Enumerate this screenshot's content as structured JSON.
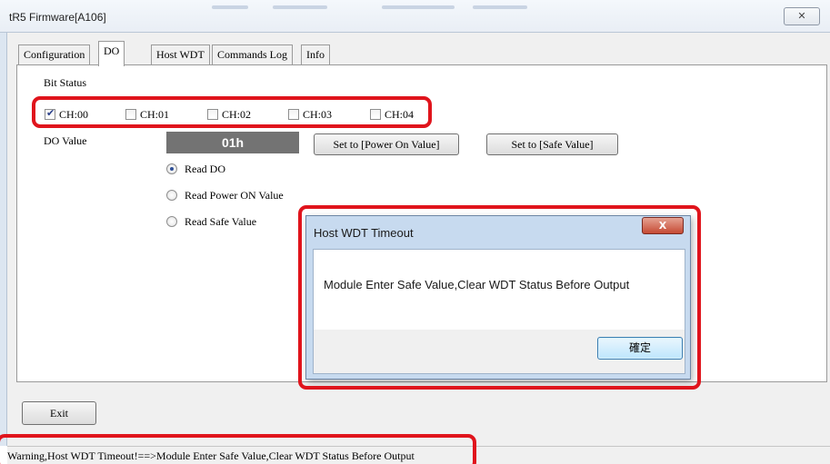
{
  "window": {
    "title": "tR5 Firmware[A106]",
    "close_glyph": "✕"
  },
  "tabs": [
    {
      "label": "Configuration",
      "active": false
    },
    {
      "label": "DO",
      "active": true
    },
    {
      "label": "Host WDT",
      "active": false
    },
    {
      "label": "Commands Log",
      "active": false
    },
    {
      "label": "Info",
      "active": false
    }
  ],
  "do_tab": {
    "bit_status_label": "Bit Status",
    "channels": [
      {
        "label": "CH:00",
        "checked": true
      },
      {
        "label": "CH:01",
        "checked": false
      },
      {
        "label": "CH:02",
        "checked": false
      },
      {
        "label": "CH:03",
        "checked": false
      },
      {
        "label": "CH:04",
        "checked": false
      }
    ],
    "do_value_label": "DO Value",
    "do_value": "01h",
    "set_power_on_button": "Set to [Power On Value]",
    "set_safe_button": "Set to [Safe Value]",
    "read_options": [
      {
        "label": "Read DO",
        "selected": true
      },
      {
        "label": "Read Power ON Value",
        "selected": false
      },
      {
        "label": "Read Safe Value",
        "selected": false
      }
    ]
  },
  "exit_button": "Exit",
  "dialog": {
    "title": "Host WDT Timeout",
    "message": "Module Enter Safe Value,Clear WDT Status Before Output",
    "ok_label": "確定",
    "close_glyph": "X"
  },
  "status": {
    "text": "Warning,Host WDT Timeout!==>Module Enter Safe Value,Clear WDT Status Before Output"
  },
  "colors": {
    "highlight": "#e0141c",
    "do_value_bg": "#737373",
    "dialog_frame": "#c7daef"
  }
}
